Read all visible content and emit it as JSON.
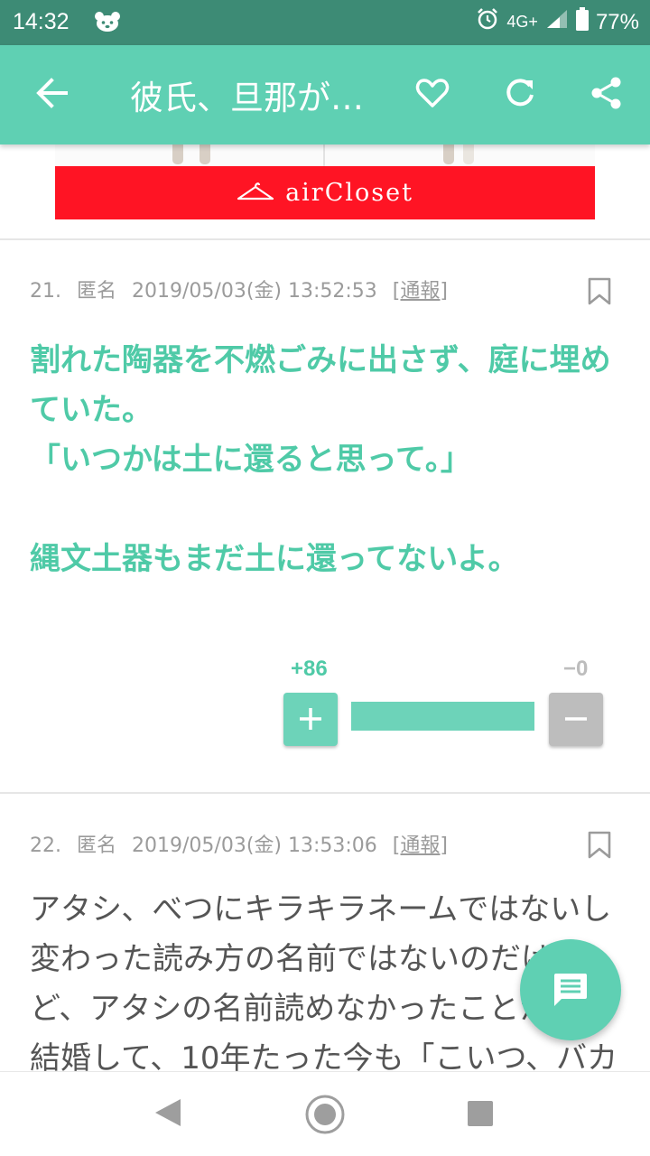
{
  "status_bar": {
    "time": "14:32",
    "network": "4G+",
    "battery": "77%",
    "icons": [
      "bear-icon",
      "alarm-icon",
      "signal-icon",
      "battery-icon"
    ]
  },
  "app_bar": {
    "title": "彼氏、旦那が…",
    "icons": [
      "back-arrow-icon",
      "heart-icon",
      "refresh-icon",
      "share-icon"
    ]
  },
  "ad": {
    "brand": "airCloset",
    "color": "#ff1424",
    "icon": "hanger-icon"
  },
  "comments": [
    {
      "number": "21.",
      "author": "匿名",
      "date": "2019/05/03(金) 13:52:53",
      "report": "[通報]",
      "body": "割れた陶器を不燃ごみに出さず、庭に埋めていた。\n「いつかは土に還ると思って。」\n\n縄文土器もまだ土に還ってないよ。",
      "votes": {
        "plus": "+86",
        "minus": "−0",
        "plus_ratio": 1.0
      }
    },
    {
      "number": "22.",
      "author": "匿名",
      "date": "2019/05/03(金) 13:53:06",
      "report": "[通報]",
      "body": "アタシ、べつにキラキラネームではないし変わった読み方の名前ではないのだけれど、アタシの名前読めなかったことかな？\n結婚して、10年たった今も「こいつ、バカなん"
    }
  ],
  "fab": {
    "icon": "comment-icon"
  },
  "nav_bar": {
    "icons": [
      "nav-back-icon",
      "nav-home-icon",
      "nav-recents-icon"
    ]
  },
  "colors": {
    "accent": "#5fd0b3",
    "status_bar": "#3d8b75",
    "green_text": "#4fcaa7",
    "ad_red": "#ff1424"
  }
}
